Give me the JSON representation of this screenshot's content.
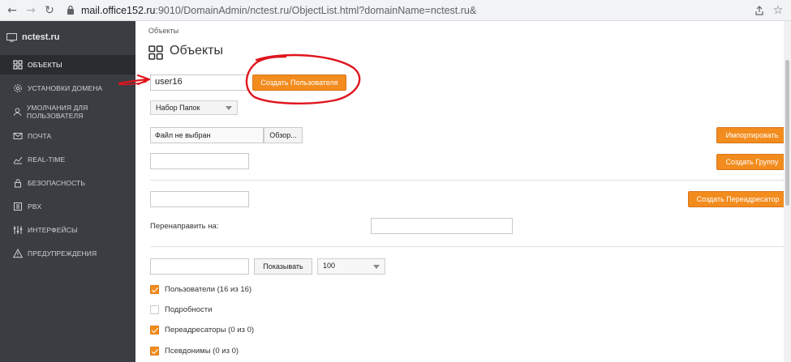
{
  "browser": {
    "url_host": "mail.office152.ru",
    "url_path": ":9010/DomainAdmin/nctest.ru/ObjectList.html?domainName=nctest.ru&"
  },
  "sidebar": {
    "domain": "nctest.ru",
    "items": [
      {
        "label": "ОБЪЕКТЫ",
        "icon": "grid-icon"
      },
      {
        "label": "УСТАНОВКИ ДОМЕНА",
        "icon": "gear-icon"
      },
      {
        "label": "УМОЛЧАНИЯ ДЛЯ ПОЛЬЗОВАТЕЛЯ",
        "icon": "user-icon"
      },
      {
        "label": "ПОЧТА",
        "icon": "envelope-icon"
      },
      {
        "label": "REAL-TIME",
        "icon": "chart-icon"
      },
      {
        "label": "БЕЗОПАСНОСТЬ",
        "icon": "lock-icon"
      },
      {
        "label": "PBX",
        "icon": "phone-icon"
      },
      {
        "label": "ИНТЕРФЕЙСЫ",
        "icon": "sliders-icon"
      },
      {
        "label": "ПРЕДУПРЕЖДЕНИЯ",
        "icon": "warning-icon"
      }
    ]
  },
  "main": {
    "breadcrumb": "Объекты",
    "title": "Объекты",
    "user_name_value": "user16",
    "create_user_label": "Создать Пользователя",
    "folder_set_select": "Набор Папок",
    "file_input_text": "Файл не выбран",
    "browse_label": "Обзор...",
    "import_label": "Импортировать",
    "create_group_label": "Создать Группу",
    "create_forwarder_label": "Создать Переадресатор",
    "redirect_label": "Перенаправить на:",
    "show_label": "Показывать",
    "page_size_select": "100",
    "filters": [
      {
        "label": "Пользователи (16 из 16)",
        "checked": true
      },
      {
        "label": "Подробности",
        "checked": false
      },
      {
        "label": "Переадресаторы (0 из 0)",
        "checked": true
      },
      {
        "label": "Псевдонимы (0 из 0)",
        "checked": true
      }
    ]
  },
  "colors": {
    "accent": "#f28c1e",
    "sidebar_bg": "#3a3d42",
    "annotation_red": "#e0141e"
  }
}
